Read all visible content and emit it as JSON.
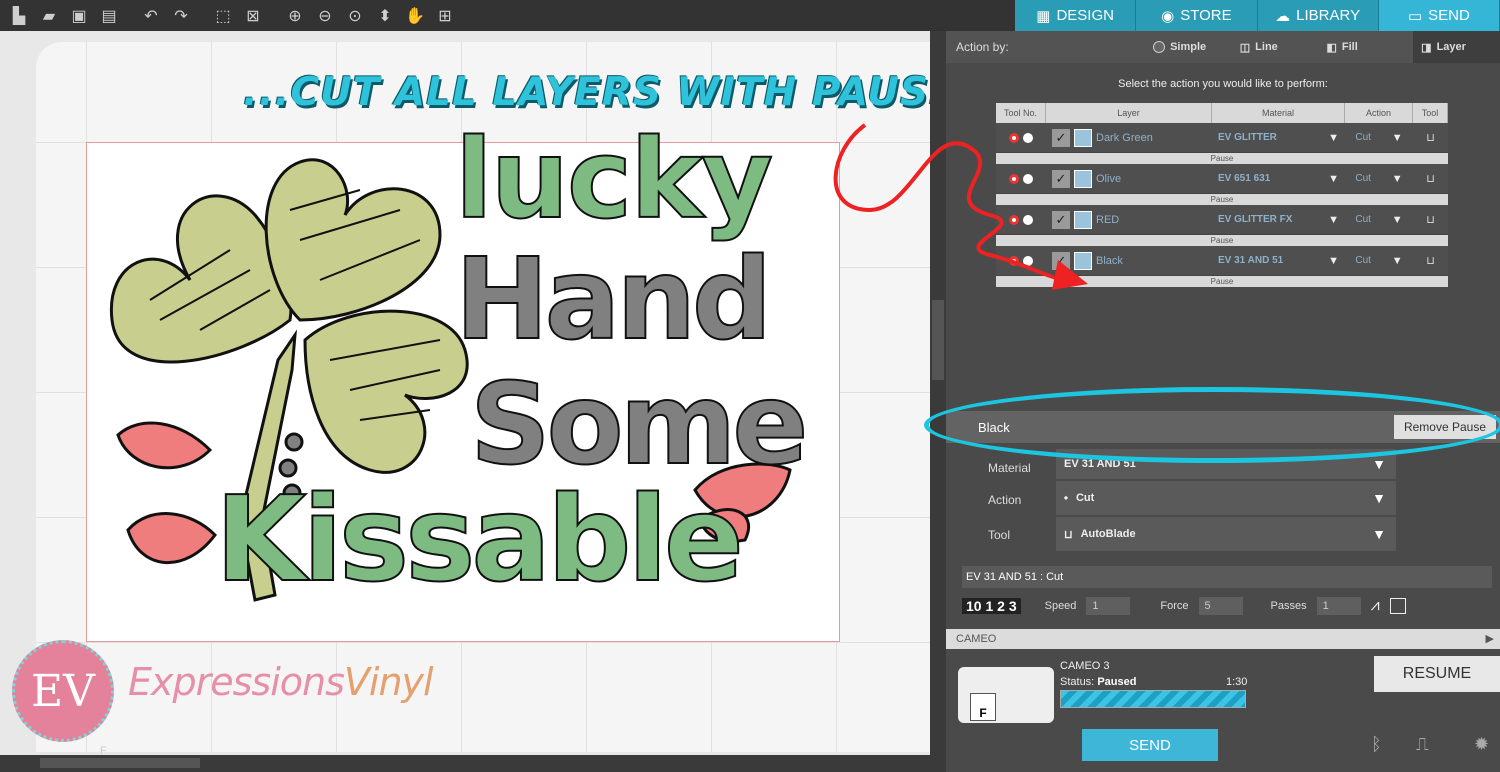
{
  "toolbar": {
    "icons": [
      "new-file-icon",
      "open-folder-icon",
      "save-icon",
      "print-icon",
      "undo-icon",
      "redo-icon",
      "select-all-icon",
      "deselect-icon",
      "zoom-in-icon",
      "zoom-out-icon",
      "zoom-box-icon",
      "move-icon",
      "pan-hand-icon",
      "fit-to-page-icon"
    ]
  },
  "tabs": [
    {
      "label": "DESIGN",
      "icon": "grid-icon",
      "active": false
    },
    {
      "label": "STORE",
      "icon": "store-icon",
      "active": false
    },
    {
      "label": "LIBRARY",
      "icon": "cloud-icon",
      "active": false
    },
    {
      "label": "SEND",
      "icon": "cutter-icon",
      "active": true
    }
  ],
  "canvas": {
    "headline": "...CUT ALL LAYERS WITH PAUSES",
    "art_words": [
      "lucky",
      "Hand",
      "Some",
      "Kissable"
    ],
    "logo_monogram": "EV",
    "logo_text_1": "Expressions",
    "logo_text_2": "Vinyl",
    "page_marker": "F"
  },
  "panel": {
    "action_by_label": "Action by:",
    "action_options": [
      "Simple",
      "Line",
      "Fill",
      "Layer"
    ],
    "selected_action_option": "Layer",
    "prompt": "Select the action you would like to perform:",
    "table_headers": [
      "Tool No.",
      "Layer",
      "Material",
      "Action",
      "Tool"
    ],
    "layers": [
      {
        "name": "Dark Green",
        "material": "EV GLITTER",
        "action": "Cut",
        "pause": "Pause"
      },
      {
        "name": "Olive",
        "material": "EV 651 631",
        "action": "Cut",
        "pause": "Pause"
      },
      {
        "name": "RED",
        "material": "EV GLITTER FX",
        "action": "Cut",
        "pause": "Pause"
      },
      {
        "name": "Black",
        "material": "EV 31 AND 51",
        "action": "Cut",
        "pause": "Pause"
      }
    ],
    "selected_layer": "Black",
    "remove_pause_label": "Remove Pause",
    "material_label": "Material",
    "material_value": "EV 31 AND 51",
    "action_label": "Action",
    "action_value": "Cut",
    "tool_label": "Tool",
    "tool_value": "AutoBlade",
    "cut_header": "EV 31 AND 51 : Cut",
    "blade_depth": "10 1 2 3",
    "speed_label": "Speed",
    "speed_value": "1",
    "force_label": "Force",
    "force_value": "5",
    "passes_label": "Passes",
    "passes_value": "1",
    "device_header": "CAMEO",
    "machine_name": "CAMEO 3",
    "status_label": "Status:",
    "status_value": "Paused",
    "time_remaining": "1:30",
    "progress": 1.0,
    "resume_label": "RESUME",
    "send_label": "SEND"
  },
  "colors": {
    "accent": "#35b6d6",
    "headline": "#2ec3da",
    "highlight": "#1cc6e0",
    "arrow": "#ee2222",
    "green": "#7dbb82",
    "olive": "#c8cf8e",
    "gray": "#808080",
    "lips": "#f07d7d"
  }
}
